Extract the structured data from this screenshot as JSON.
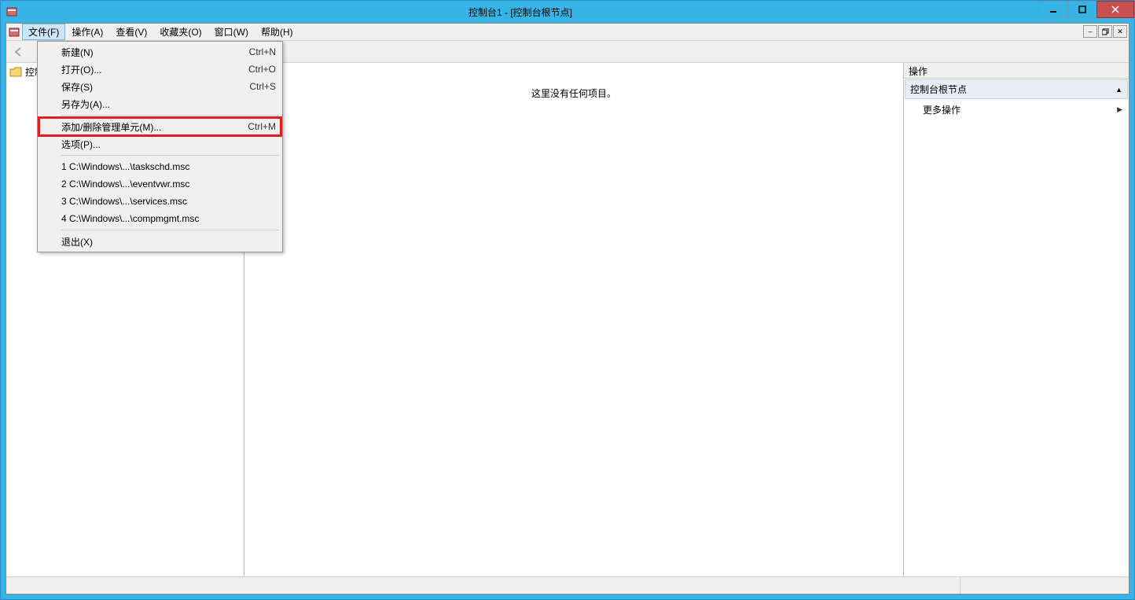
{
  "window": {
    "title": "控制台1 - [控制台根节点]"
  },
  "menubar": {
    "file": "文件(F)",
    "action": "操作(A)",
    "view": "查看(V)",
    "favorites": "收藏夹(O)",
    "window": "窗口(W)",
    "help": "帮助(H)"
  },
  "file_menu": {
    "new": {
      "label": "新建(N)",
      "shortcut": "Ctrl+N"
    },
    "open": {
      "label": "打开(O)...",
      "shortcut": "Ctrl+O"
    },
    "save": {
      "label": "保存(S)",
      "shortcut": "Ctrl+S"
    },
    "save_as": {
      "label": "另存为(A)...",
      "shortcut": ""
    },
    "add_remove": {
      "label": "添加/删除管理单元(M)...",
      "shortcut": "Ctrl+M"
    },
    "options": {
      "label": "选项(P)...",
      "shortcut": ""
    },
    "recent1": {
      "label": "1 C:\\Windows\\...\\taskschd.msc",
      "shortcut": ""
    },
    "recent2": {
      "label": "2 C:\\Windows\\...\\eventvwr.msc",
      "shortcut": ""
    },
    "recent3": {
      "label": "3 C:\\Windows\\...\\services.msc",
      "shortcut": ""
    },
    "recent4": {
      "label": "4 C:\\Windows\\...\\compmgmt.msc",
      "shortcut": ""
    },
    "exit": {
      "label": "退出(X)",
      "shortcut": ""
    }
  },
  "tree": {
    "root": "控制台根节点"
  },
  "list": {
    "empty_text": "这里没有任何项目。"
  },
  "actions": {
    "header": "操作",
    "group_title": "控制台根节点",
    "more_actions": "更多操作"
  }
}
